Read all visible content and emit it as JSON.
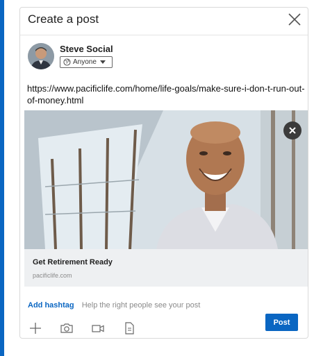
{
  "modal": {
    "title": "Create a post",
    "close_icon": "close-icon"
  },
  "author": {
    "name": "Steve Social",
    "visibility": "Anyone"
  },
  "post": {
    "text": "https://www.pacificlife.com/home/life-goals/make-sure-i-don-t-run-out-of-money.html"
  },
  "link_preview": {
    "title": "Get Retirement Ready",
    "domain": "pacificlife.com"
  },
  "hashtag": {
    "label": "Add hashtag",
    "hint": "Help the right people see your post"
  },
  "toolbar": {
    "icons": [
      "plus-icon",
      "camera-icon",
      "video-icon",
      "document-icon"
    ],
    "post_label": "Post"
  },
  "colors": {
    "accent": "#0a66c2",
    "preview_background": "#eef0f2"
  }
}
